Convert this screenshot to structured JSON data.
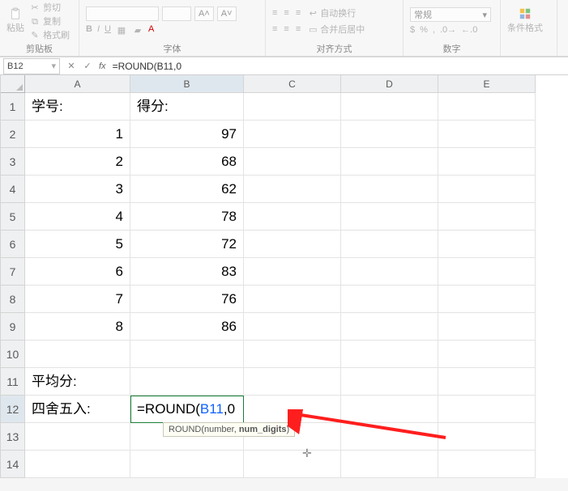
{
  "ribbon": {
    "clipboard": {
      "paste": "粘贴",
      "cut_label": "剪切",
      "copy_label": "复制",
      "format_painter": "格式刷",
      "group_label": "剪贴板"
    },
    "font": {
      "bold": "B",
      "italic": "I",
      "underline": "U",
      "group_label": "字体"
    },
    "align": {
      "wrap_label": "自动换行",
      "merge_label": "合并后居中",
      "group_label": "对齐方式"
    },
    "number": {
      "style_label": "常规",
      "group_label": "数字"
    },
    "styles": {
      "cond_format": "条件格式",
      "group_label": ""
    }
  },
  "formula_bar": {
    "name_box": "B12",
    "cancel": "✕",
    "confirm": "✓",
    "fx": "fx",
    "formula": "=ROUND(B11,0"
  },
  "columns": [
    "A",
    "B",
    "C",
    "D",
    "E"
  ],
  "rows": [
    "1",
    "2",
    "3",
    "4",
    "5",
    "6",
    "7",
    "8",
    "9",
    "10",
    "11",
    "12",
    "13",
    "14"
  ],
  "cells": {
    "A1": "学号:",
    "B1": "得分:",
    "A2": "1",
    "B2": "97",
    "A3": "2",
    "B3": "68",
    "A4": "3",
    "B4": "62",
    "A5": "4",
    "B5": "78",
    "A6": "5",
    "B6": "72",
    "A7": "6",
    "B7": "83",
    "A8": "7",
    "B8": "76",
    "A9": "8",
    "B9": "86",
    "A11": "平均分:",
    "A12": "四舍五入:"
  },
  "active_cell": {
    "prefix": "=ROUND(",
    "ref": "B11",
    "suffix": ",0"
  },
  "tooltip": {
    "func": "ROUND(",
    "arg1": "number",
    "sep": ", ",
    "arg2": "num_digits",
    "end": ")"
  }
}
